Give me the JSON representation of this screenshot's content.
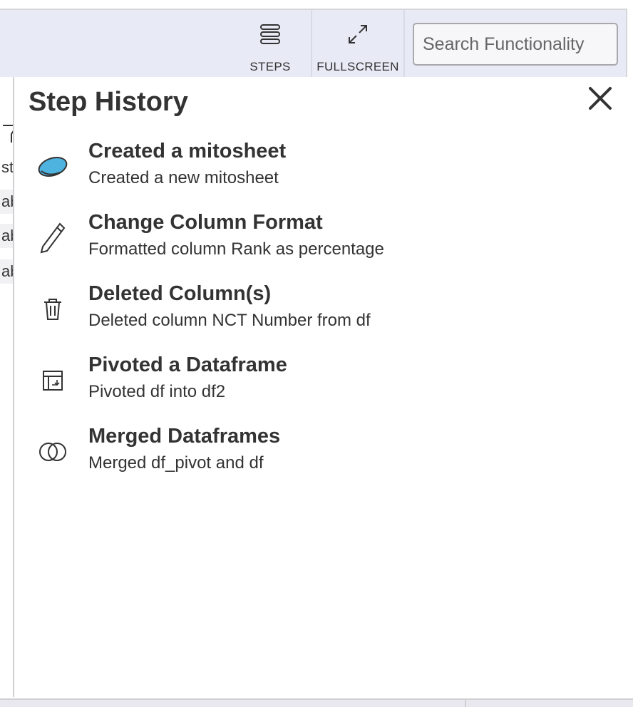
{
  "toolbar": {
    "steps_label": "STEPS",
    "steps_icon": "layers-icon",
    "fullscreen_label": "FULLSCREEN",
    "fullscreen_icon": "expand-icon",
    "search_placeholder": "Search Functionality"
  },
  "left_strip": {
    "cells": [
      "st",
      "ab",
      "ab",
      "ab"
    ]
  },
  "panel": {
    "title": "Step History",
    "close_icon": "close-icon",
    "steps": [
      {
        "icon": "mito-logo-icon",
        "title": "Created a mitosheet",
        "description": "Created a new mitosheet"
      },
      {
        "icon": "pencil-icon",
        "title": "Change Column Format",
        "description": "Formatted column Rank as percentage"
      },
      {
        "icon": "trash-icon",
        "title": "Deleted Column(s)",
        "description": "Deleted column NCT Number from df"
      },
      {
        "icon": "pivot-table-icon",
        "title": "Pivoted a Dataframe",
        "description": "Pivoted df into df2"
      },
      {
        "icon": "merge-icon",
        "title": "Merged Dataframes",
        "description": "Merged df_pivot and df"
      }
    ]
  },
  "colors": {
    "toolbar_bg": "#e8eaf6",
    "text": "#333333",
    "mito_logo": "#4fb3e0"
  }
}
